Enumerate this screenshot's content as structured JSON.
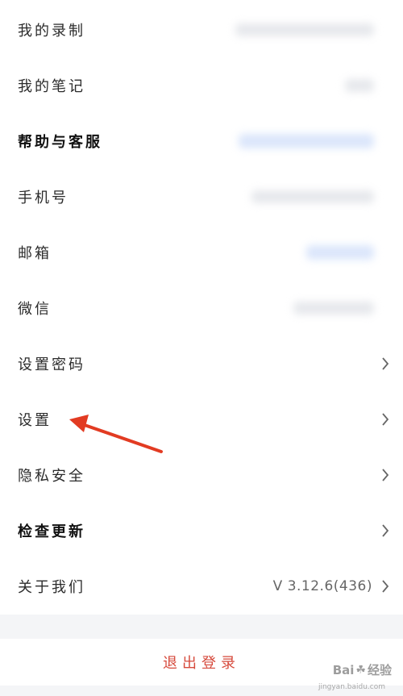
{
  "menu": {
    "items": [
      {
        "label": "我的录制"
      },
      {
        "label": "我的笔记"
      },
      {
        "label": "帮助与客服"
      },
      {
        "label": "手机号"
      },
      {
        "label": "邮箱"
      },
      {
        "label": "微信"
      },
      {
        "label": "设置密码"
      },
      {
        "label": "设置"
      },
      {
        "label": "隐私安全"
      },
      {
        "label": "检查更新"
      },
      {
        "label": "关于我们",
        "value": "V 3.12.6(436)"
      }
    ]
  },
  "logout_label": "退出登录",
  "watermark": {
    "brand_left": "Bai",
    "brand_right": "经验",
    "url": "jingyan.baidu.com"
  },
  "colors": {
    "logout_text": "#d64a3c",
    "annotation_arrow": "#e23b22",
    "section_gap": "#f4f5f7"
  }
}
